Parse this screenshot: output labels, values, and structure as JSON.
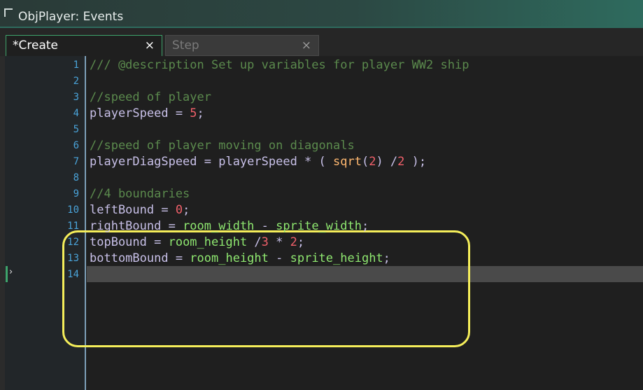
{
  "window": {
    "title": "ObjPlayer: Events"
  },
  "tabs": [
    {
      "label": "*Create",
      "close": "×",
      "active": true
    },
    {
      "label": "Step",
      "close": "×",
      "active": false
    }
  ],
  "editor": {
    "current_line": 14,
    "line_numbers": [
      "1",
      "2",
      "3",
      "4",
      "5",
      "6",
      "7",
      "8",
      "9",
      "10",
      "11",
      "12",
      "13",
      "14"
    ],
    "lines": [
      [
        {
          "t": "/// @description Set up variables for player WW2 ship",
          "c": "comment"
        }
      ],
      [],
      [
        {
          "t": "//speed of player",
          "c": "comment"
        }
      ],
      [
        {
          "t": "playerSpeed = ",
          "c": "var"
        },
        {
          "t": "5",
          "c": "num"
        },
        {
          "t": ";",
          "c": "var"
        }
      ],
      [],
      [
        {
          "t": "//speed of player moving on diagonals",
          "c": "comment"
        }
      ],
      [
        {
          "t": "playerDiagSpeed = playerSpeed * ( ",
          "c": "var"
        },
        {
          "t": "sqrt",
          "c": "fn"
        },
        {
          "t": "(",
          "c": "var"
        },
        {
          "t": "2",
          "c": "num"
        },
        {
          "t": ") /",
          "c": "var"
        },
        {
          "t": "2",
          "c": "num"
        },
        {
          "t": " );",
          "c": "var"
        }
      ],
      [],
      [
        {
          "t": "//4 boundaries",
          "c": "comment"
        }
      ],
      [
        {
          "t": "leftBound = ",
          "c": "var"
        },
        {
          "t": "0",
          "c": "num"
        },
        {
          "t": ";",
          "c": "var"
        }
      ],
      [
        {
          "t": "rightBound = ",
          "c": "var"
        },
        {
          "t": "room_width",
          "c": "builtin"
        },
        {
          "t": " - ",
          "c": "var"
        },
        {
          "t": "sprite_width",
          "c": "builtin"
        },
        {
          "t": ";",
          "c": "var"
        }
      ],
      [
        {
          "t": "topBound = ",
          "c": "var"
        },
        {
          "t": "room_height",
          "c": "builtin"
        },
        {
          "t": " /",
          "c": "var"
        },
        {
          "t": "3",
          "c": "num"
        },
        {
          "t": " * ",
          "c": "var"
        },
        {
          "t": "2",
          "c": "num"
        },
        {
          "t": ";",
          "c": "var"
        }
      ],
      [
        {
          "t": "bottomBound = ",
          "c": "var"
        },
        {
          "t": "room_height",
          "c": "builtin"
        },
        {
          "t": " - ",
          "c": "var"
        },
        {
          "t": "sprite_height",
          "c": "builtin"
        },
        {
          "t": ";",
          "c": "var"
        }
      ],
      []
    ]
  },
  "colors": {
    "accent": "#3ea36b",
    "line_number": "#4aa3d9",
    "comment": "#5b8a4d",
    "number": "#f0606a",
    "builtin": "#8fe870",
    "function": "#ffb870",
    "variable": "#c8c0e8",
    "annotation_box": "#f5ee5a"
  },
  "icons": {
    "caret_marker": "chevron-right-icon"
  }
}
